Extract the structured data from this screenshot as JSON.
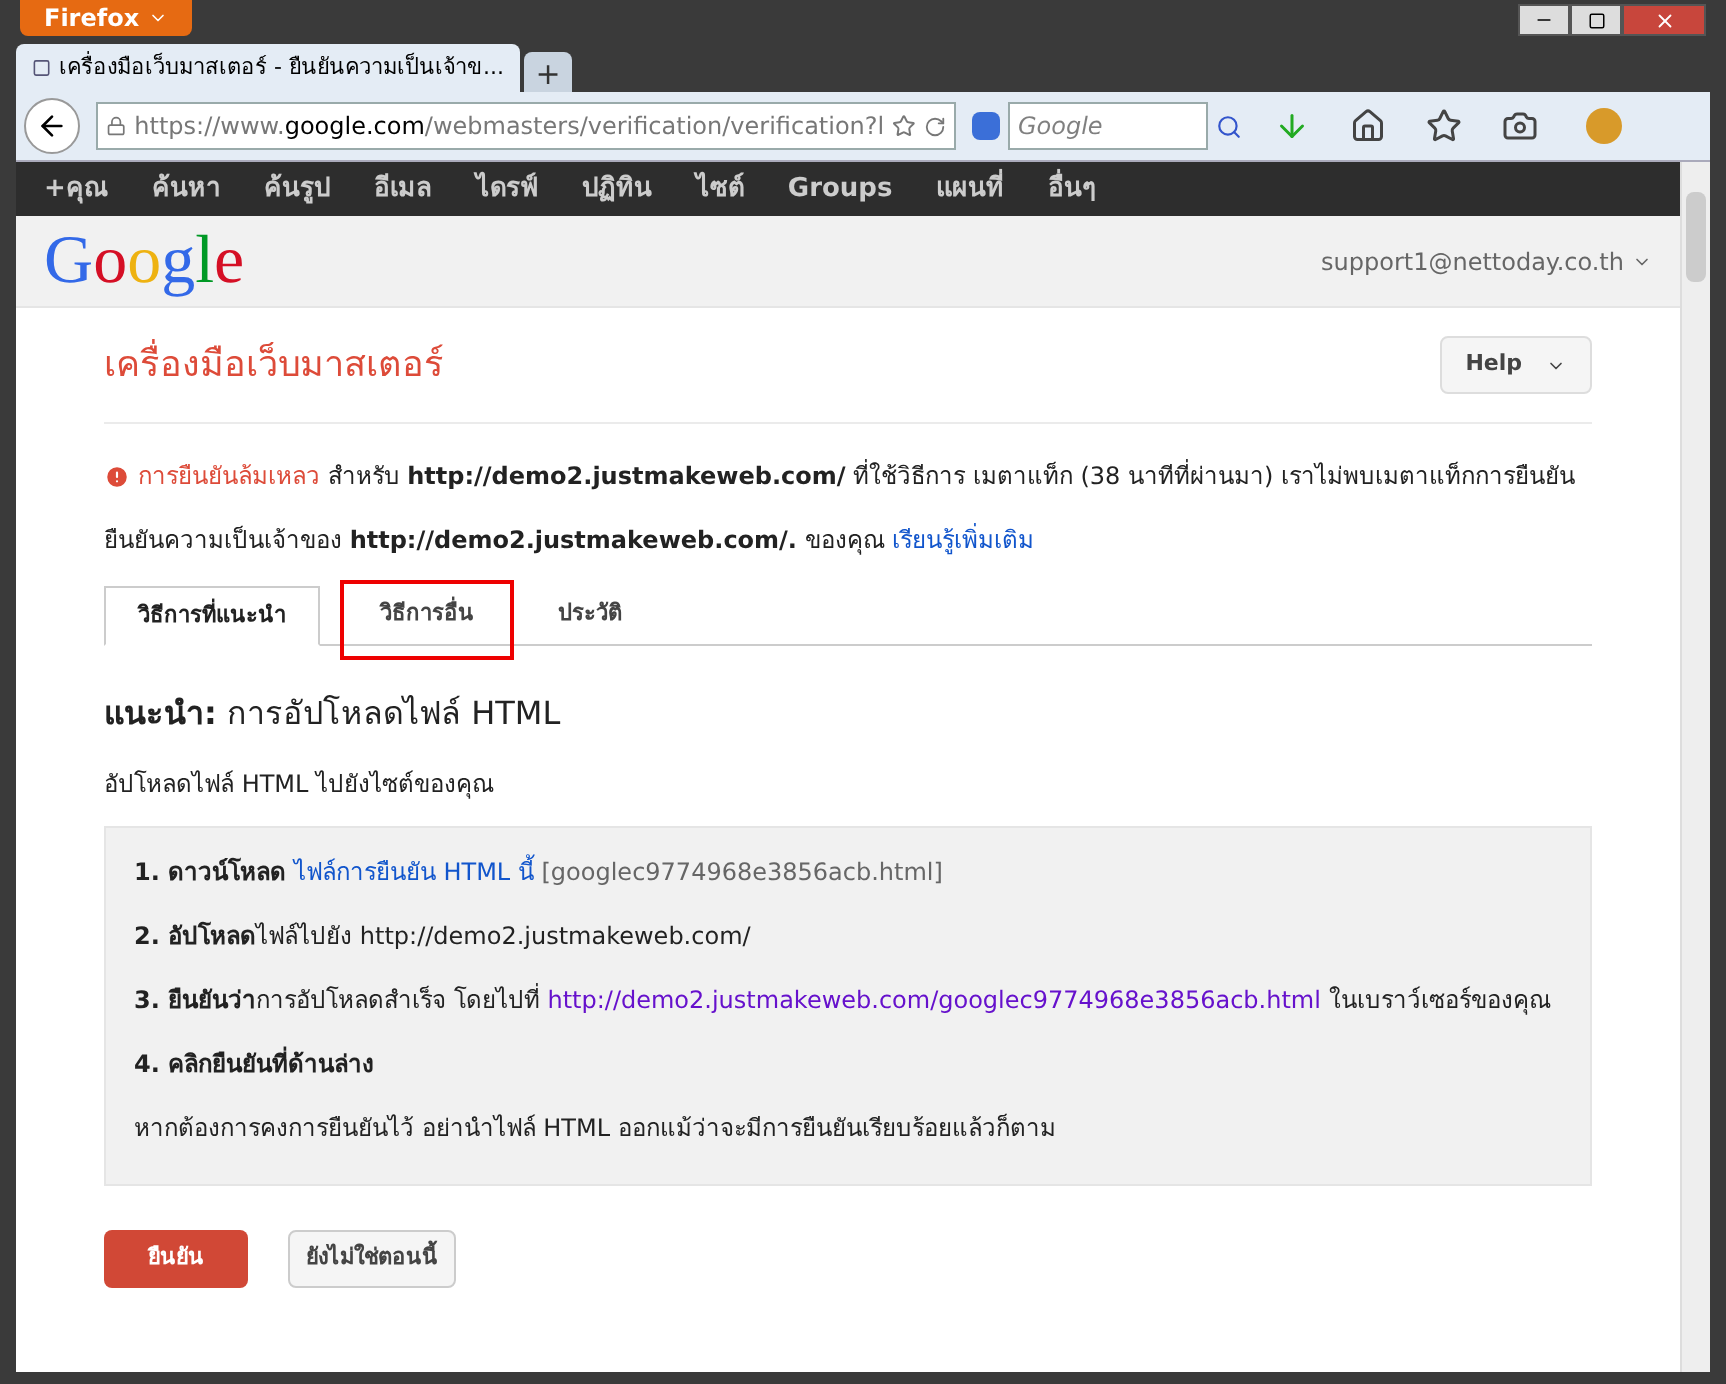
{
  "browser": {
    "menu_button": "Firefox",
    "tab_title": "เครื่องมือเว็บมาสเตอร์ - ยืนยันความเป็นเจ้าข...",
    "new_tab": "+",
    "url": {
      "prefix": "https://www.",
      "domain": "google.com",
      "path": "/webmasters/verification/verification?l"
    },
    "search_placeholder": "Google"
  },
  "google_bar": [
    "+คุณ",
    "ค้นหา",
    "ค้นรูป",
    "อีเมล",
    "ไดรฟ์",
    "ปฏิทิน",
    "ไซต์",
    "Groups",
    "แผนที่",
    "อื่นๆ"
  ],
  "logo": "Google",
  "account": "support1@nettoday.co.th",
  "page_title": "เครื่องมือเว็บมาสเตอร์",
  "help_button": "Help",
  "error": {
    "lines": [
      [
        {
          "kind": "error",
          "text": "การยืนยันล้มเหลว"
        },
        {
          "kind": "text",
          "text": " สำหรับ "
        },
        {
          "kind": "bold",
          "text": "http://demo2.justmakeweb.com/"
        },
        {
          "kind": "text",
          "text": " ที่ใช้วิธีการ เมตาแท็ก (38 นาทีที่ผ่านมา) เราไม่พบเมตาแท็กการยืนยัน"
        }
      ],
      [
        {
          "kind": "text",
          "text": "ยืนยันความเป็นเจ้าของ "
        },
        {
          "kind": "bold",
          "text": "http://demo2.justmakeweb.com/."
        },
        {
          "kind": "text",
          "text": " ของคุณ "
        },
        {
          "kind": "link",
          "text": "เรียนรู้เพิ่มเติม"
        }
      ]
    ]
  },
  "tabs": [
    {
      "label": "วิธีการที่แนะนำ",
      "selected": true,
      "highlighted": false
    },
    {
      "label": "วิธีการอื่น",
      "selected": false,
      "highlighted": true
    },
    {
      "label": "ประวัติ",
      "selected": false,
      "highlighted": false
    }
  ],
  "method_heading": {
    "label": "แนะนำ:",
    "title": "การอัปโหลดไฟล์ HTML"
  },
  "method_description": "อัปโหลดไฟล์ HTML ไปยังไซต์ของคุณ",
  "steps": [
    [
      {
        "kind": "bold",
        "text": "1. ดาวน์โหลด"
      },
      {
        "kind": "link",
        "text": " ไฟล์การยืนยัน HTML นี้"
      },
      {
        "kind": "muted",
        "text": " [googlec9774968e3856acb.html]"
      }
    ],
    [
      {
        "kind": "bold",
        "text": "2. อัปโหลด"
      },
      {
        "kind": "text",
        "text": "ไฟล์ไปยัง http://demo2.justmakeweb.com/"
      }
    ],
    [
      {
        "kind": "bold",
        "text": "3. ยืนยันว่า"
      },
      {
        "kind": "text",
        "text": "การอัปโหลดสำเร็จ โดยไปที่ "
      },
      {
        "kind": "visited",
        "text": "http://demo2.justmakeweb.com/googlec9774968e3856acb.html"
      },
      {
        "kind": "text",
        "text": " ในเบราว์เซอร์ของคุณ"
      }
    ],
    [
      {
        "kind": "bold",
        "text": "4. คลิกยืนยันที่ด้านล่าง"
      }
    ],
    [
      {
        "kind": "text",
        "text": "หากต้องการคงการยืนยันไว้ อย่านำไฟล์ HTML ออกแม้ว่าจะมีการยืนยันเรียบร้อยแล้วก็ตาม"
      }
    ]
  ],
  "buttons": {
    "primary": "ยืนยัน",
    "secondary": "ยังไม่ใช่ตอนนี้"
  }
}
